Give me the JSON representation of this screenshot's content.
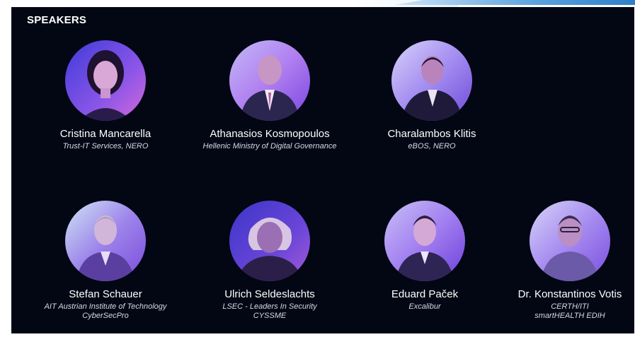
{
  "section_title": "SPEAKERS",
  "speakers": [
    {
      "name": "Cristina Mancarella",
      "affiliation_line1": "Trust-IT Services, NERO",
      "affiliation_line2": ""
    },
    {
      "name": "Athanasios Kosmopoulos",
      "affiliation_line1": "Hellenic Ministry of Digital Governance",
      "affiliation_line2": ""
    },
    {
      "name": "Charalambos Klitis",
      "affiliation_line1": "eBOS, NERO",
      "affiliation_line2": ""
    },
    {
      "name": "Stefan Schauer",
      "affiliation_line1": "AIT Austrian Institute of Technology",
      "affiliation_line2": "CyberSecPro"
    },
    {
      "name": "Ulrich Seldeslachts",
      "affiliation_line1": "LSEC - Leaders In Security",
      "affiliation_line2": "CYSSME"
    },
    {
      "name": "Eduard Paček",
      "affiliation_line1": "Excalibur",
      "affiliation_line2": ""
    },
    {
      "name": "Dr. Konstantinos Votis",
      "affiliation_line1": "CERTH/ITI",
      "affiliation_line2": "smartHEALTH EDIH"
    }
  ]
}
